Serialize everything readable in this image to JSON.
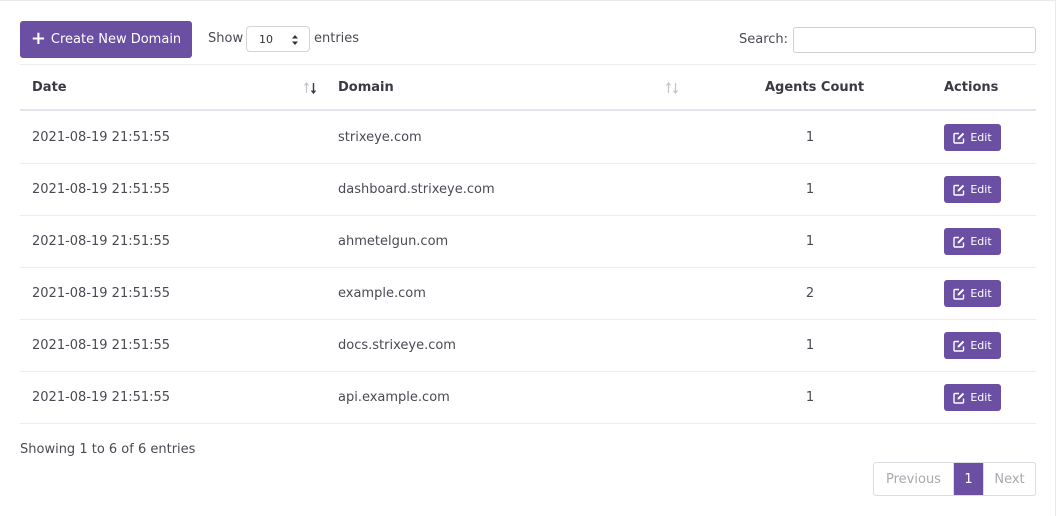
{
  "toolbar": {
    "create_label": "Create New Domain",
    "show_label": "Show",
    "page_length": "10",
    "entries_label": "entries",
    "search_label": "Search:",
    "search_value": ""
  },
  "table": {
    "columns": [
      "Date",
      "Domain",
      "Agents Count",
      "Actions"
    ],
    "edit_label": "Edit",
    "rows": [
      {
        "date": "2021-08-19 21:51:55",
        "domain": "strixeye.com",
        "count": "1"
      },
      {
        "date": "2021-08-19 21:51:55",
        "domain": "dashboard.strixeye.com",
        "count": "1"
      },
      {
        "date": "2021-08-19 21:51:55",
        "domain": "ahmetelgun.com",
        "count": "1"
      },
      {
        "date": "2021-08-19 21:51:55",
        "domain": "example.com",
        "count": "2"
      },
      {
        "date": "2021-08-19 21:51:55",
        "domain": "docs.strixeye.com",
        "count": "1"
      },
      {
        "date": "2021-08-19 21:51:55",
        "domain": "api.example.com",
        "count": "1"
      }
    ]
  },
  "footer": {
    "info": "Showing 1 to 6 of 6 entries",
    "prev_label": "Previous",
    "page": "1",
    "next_label": "Next"
  },
  "colors": {
    "accent": "#6b4fa3"
  },
  "icons": {
    "create": "plus-icon",
    "edit": "edit-icon",
    "sort_active": "sort-desc-icon",
    "sort": "sort-both-icon"
  }
}
